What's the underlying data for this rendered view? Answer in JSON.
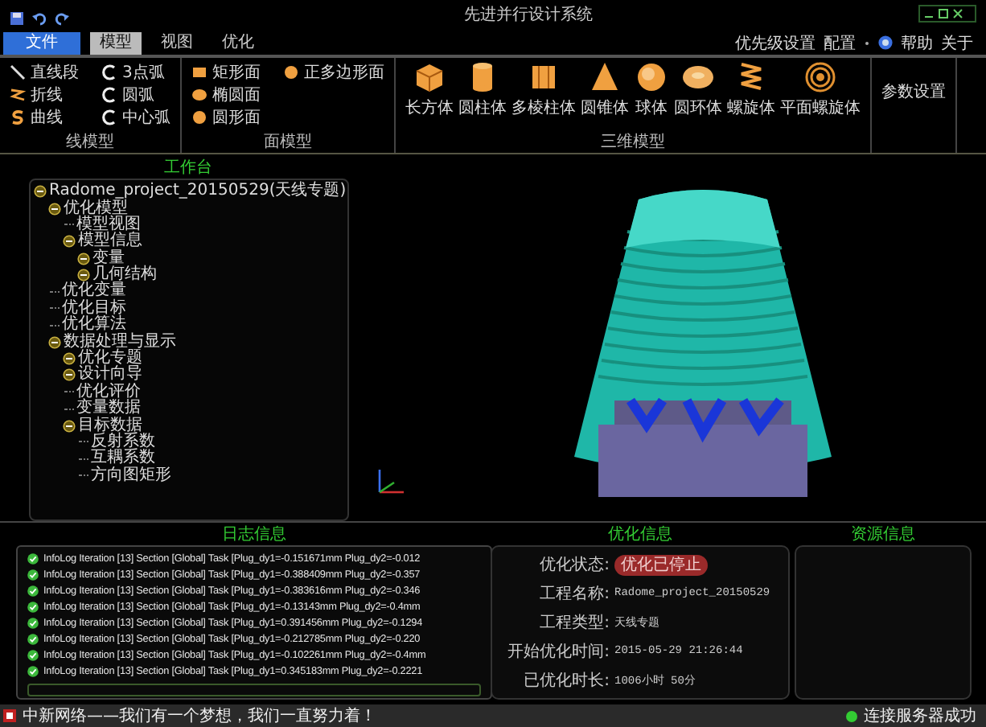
{
  "window": {
    "title": "先进并行设计系统"
  },
  "menu_tabs": [
    {
      "label": "文件",
      "selected": false,
      "kind": "file"
    },
    {
      "label": "模型",
      "selected": true,
      "kind": "tab"
    },
    {
      "label": "视图",
      "selected": false,
      "kind": "tab"
    },
    {
      "label": "优化",
      "selected": false,
      "kind": "tab"
    }
  ],
  "top_links": [
    {
      "label": "优先级设置",
      "kind": "link"
    },
    {
      "label": "配置",
      "kind": "dropdown"
    },
    {
      "label": "帮助",
      "kind": "help"
    },
    {
      "label": "关于",
      "kind": "link"
    }
  ],
  "ribbon": [
    {
      "title": "线模型",
      "kind": "small",
      "items": [
        "直线段",
        "折线",
        "曲线",
        "3点弧",
        "圆弧",
        "中心弧"
      ]
    },
    {
      "title": "面模型",
      "kind": "small",
      "items": [
        "矩形面",
        "椭圆面",
        "圆形面",
        "正多边形面"
      ]
    },
    {
      "title": "三维模型",
      "kind": "large",
      "items": [
        "长方体",
        "圆柱体",
        "多棱柱体",
        "圆锥体",
        "球体",
        "圆环体",
        "螺旋体",
        "平面螺旋体"
      ]
    },
    {
      "kind": "button",
      "items": [
        "参数设置"
      ]
    }
  ],
  "workbench": {
    "title": "工作台",
    "tree": [
      {
        "label": "Radome_project_20150529(天线专题)",
        "expandable": true,
        "children": [
          {
            "label": "优化模型",
            "expandable": true,
            "children": [
              {
                "label": "模型视图",
                "expandable": false
              },
              {
                "label": "模型信息",
                "expandable": true,
                "children": [
                  {
                    "label": "变量",
                    "expandable": true
                  },
                  {
                    "label": "几何结构",
                    "expandable": true
                  }
                ]
              }
            ]
          },
          {
            "label": "优化变量",
            "expandable": false
          },
          {
            "label": "优化目标",
            "expandable": false
          },
          {
            "label": "优化算法",
            "expandable": false
          },
          {
            "label": "数据处理与显示",
            "expandable": true,
            "children": [
              {
                "label": "优化专题",
                "expandable": true
              },
              {
                "label": "设计向导",
                "expandable": true
              },
              {
                "label": "优化评价",
                "expandable": false
              },
              {
                "label": "变量数据",
                "expandable": false
              },
              {
                "label": "目标数据",
                "expandable": true,
                "children": [
                  {
                    "label": "反射系数",
                    "expandable": false
                  },
                  {
                    "label": "互耦系数",
                    "expandable": false
                  },
                  {
                    "label": "方向图矩形",
                    "expandable": false
                  }
                ]
              }
            ]
          }
        ]
      }
    ]
  },
  "log": {
    "title": "日志信息",
    "rows": [
      "InfoLog Iteration [13] Section [Global] Task [Plug_dy1=-0.151671mm Plug_dy2=-0.012",
      "InfoLog Iteration [13] Section [Global] Task [Plug_dy1=-0.388409mm Plug_dy2=-0.357",
      "InfoLog Iteration [13] Section [Global] Task [Plug_dy1=-0.383616mm Plug_dy2=-0.346",
      "InfoLog Iteration [13] Section [Global] Task [Plug_dy1=-0.13143mm Plug_dy2=-0.4mm",
      "InfoLog Iteration [13] Section [Global] Task [Plug_dy1=0.391456mm Plug_dy2=-0.1294",
      "InfoLog Iteration [13] Section [Global] Task [Plug_dy1=-0.212785mm Plug_dy2=-0.220",
      "InfoLog Iteration [13] Section [Global] Task [Plug_dy1=-0.102261mm Plug_dy2=-0.4mm",
      "InfoLog Iteration [13] Section [Global] Task [Plug_dy1=0.345183mm Plug_dy2=-0.2221"
    ]
  },
  "optimization": {
    "title": "优化信息",
    "fields": [
      {
        "label": "优化状态:",
        "value": "优化已停止",
        "kind": "badge"
      },
      {
        "label": "工程名称:",
        "value": "Radome_project_20150529",
        "kind": "text"
      },
      {
        "label": "工程类型:",
        "value": "天线专题",
        "kind": "text"
      },
      {
        "label": "开始优化时间:",
        "value": "2015-05-29 21:26:44",
        "kind": "text"
      },
      {
        "label": "已优化时长:",
        "value": "1006小时 50分",
        "kind": "text"
      }
    ]
  },
  "resources": {
    "title": "资源信息"
  },
  "status_bar": {
    "message": "中新网络——我们有一个梦想，我们一直努力着！",
    "connection": "连接服务器成功",
    "connected": true
  }
}
